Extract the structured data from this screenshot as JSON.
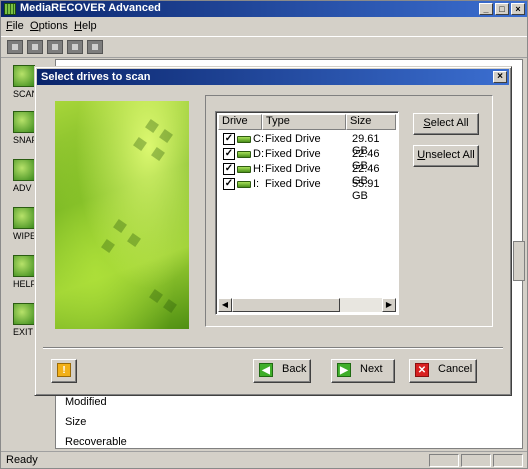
{
  "app": {
    "title": "MediaRECOVER Advanced",
    "menu": [
      {
        "label": "File",
        "u": "F",
        "rest": "ile"
      },
      {
        "label": "Options",
        "u": "O",
        "rest": "ptions"
      },
      {
        "label": "Help",
        "u": "H",
        "rest": "elp"
      }
    ],
    "sidebar": [
      {
        "label": "SCAN"
      },
      {
        "label": "SNAPSHOT"
      },
      {
        "label": "ADV SCAN"
      },
      {
        "label": "WIPE"
      },
      {
        "label": "HELP"
      },
      {
        "label": "EXIT"
      }
    ],
    "details": [
      "Modified",
      "Size",
      "Recoverable"
    ],
    "status": "Ready"
  },
  "dialog": {
    "title": "Select drives to scan",
    "columns": [
      "Drive",
      "Type",
      "Size"
    ],
    "drives": [
      {
        "letter": "C:",
        "type": "Fixed Drive",
        "size": "29.61 GB",
        "checked": true
      },
      {
        "letter": "D:",
        "type": "Fixed Drive",
        "size": "22.46 GB",
        "checked": true
      },
      {
        "letter": "H:",
        "type": "Fixed Drive",
        "size": "22.46 GB",
        "checked": true
      },
      {
        "letter": "I:",
        "type": "Fixed Drive",
        "size": "55.91 GB",
        "checked": true
      }
    ],
    "select_all": {
      "u": "S",
      "rest": "elect All"
    },
    "unselect_all": {
      "u": "U",
      "rest": "nselect All"
    },
    "back": "Back",
    "next": "Next",
    "cancel": "Cancel"
  }
}
